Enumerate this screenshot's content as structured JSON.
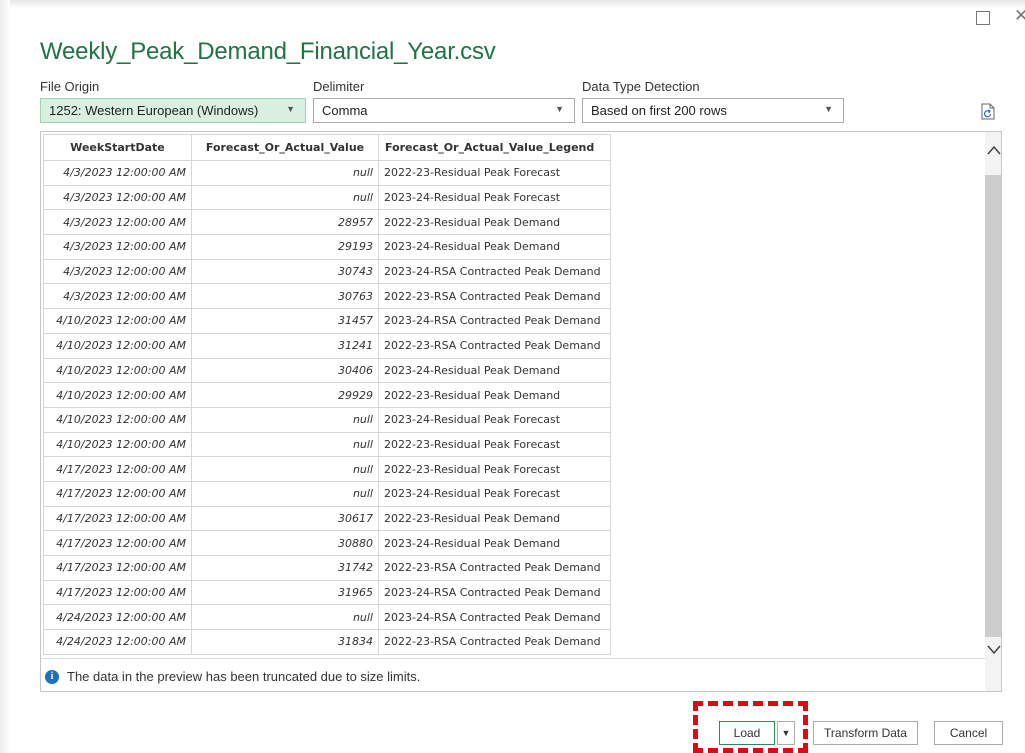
{
  "window": {
    "maximize_glyph": "☐",
    "close_glyph": "✕"
  },
  "title": "Weekly_Peak_Demand_Financial_Year.csv",
  "file_origin": {
    "label": "File Origin",
    "value": "1252: Western European (Windows)"
  },
  "delimiter": {
    "label": "Delimiter",
    "value": "Comma"
  },
  "data_type_detection": {
    "label": "Data Type Detection",
    "value": "Based on first 200 rows"
  },
  "table": {
    "columns": [
      "WeekStartDate",
      "Forecast_Or_Actual_Value",
      "Forecast_Or_Actual_Value_Legend"
    ],
    "rows": [
      [
        "4/3/2023 12:00:00 AM",
        "null",
        "2022-23-Residual Peak Forecast"
      ],
      [
        "4/3/2023 12:00:00 AM",
        "null",
        "2023-24-Residual Peak Forecast"
      ],
      [
        "4/3/2023 12:00:00 AM",
        "28957",
        "2022-23-Residual Peak Demand"
      ],
      [
        "4/3/2023 12:00:00 AM",
        "29193",
        "2023-24-Residual Peak Demand"
      ],
      [
        "4/3/2023 12:00:00 AM",
        "30743",
        "2023-24-RSA Contracted Peak Demand"
      ],
      [
        "4/3/2023 12:00:00 AM",
        "30763",
        "2022-23-RSA Contracted Peak Demand"
      ],
      [
        "4/10/2023 12:00:00 AM",
        "31457",
        "2023-24-RSA Contracted Peak Demand"
      ],
      [
        "4/10/2023 12:00:00 AM",
        "31241",
        "2022-23-RSA Contracted Peak Demand"
      ],
      [
        "4/10/2023 12:00:00 AM",
        "30406",
        "2023-24-Residual Peak Demand"
      ],
      [
        "4/10/2023 12:00:00 AM",
        "29929",
        "2022-23-Residual Peak Demand"
      ],
      [
        "4/10/2023 12:00:00 AM",
        "null",
        "2023-24-Residual Peak Forecast"
      ],
      [
        "4/10/2023 12:00:00 AM",
        "null",
        "2022-23-Residual Peak Forecast"
      ],
      [
        "4/17/2023 12:00:00 AM",
        "null",
        "2022-23-Residual Peak Forecast"
      ],
      [
        "4/17/2023 12:00:00 AM",
        "null",
        "2023-24-Residual Peak Forecast"
      ],
      [
        "4/17/2023 12:00:00 AM",
        "30617",
        "2022-23-Residual Peak Demand"
      ],
      [
        "4/17/2023 12:00:00 AM",
        "30880",
        "2023-24-Residual Peak Demand"
      ],
      [
        "4/17/2023 12:00:00 AM",
        "31742",
        "2022-23-RSA Contracted Peak Demand"
      ],
      [
        "4/17/2023 12:00:00 AM",
        "31965",
        "2023-24-RSA Contracted Peak Demand"
      ],
      [
        "4/24/2023 12:00:00 AM",
        "null",
        "2023-24-RSA Contracted Peak Demand"
      ],
      [
        "4/24/2023 12:00:00 AM",
        "31834",
        "2022-23-RSA Contracted Peak Demand"
      ]
    ]
  },
  "info_message": "The data in the preview has been truncated due to size limits.",
  "buttons": {
    "load": "Load",
    "transform": "Transform Data",
    "cancel": "Cancel"
  },
  "colors": {
    "title": "#217346",
    "highlight": "#e30613",
    "info_icon": "#1f6fc5"
  }
}
